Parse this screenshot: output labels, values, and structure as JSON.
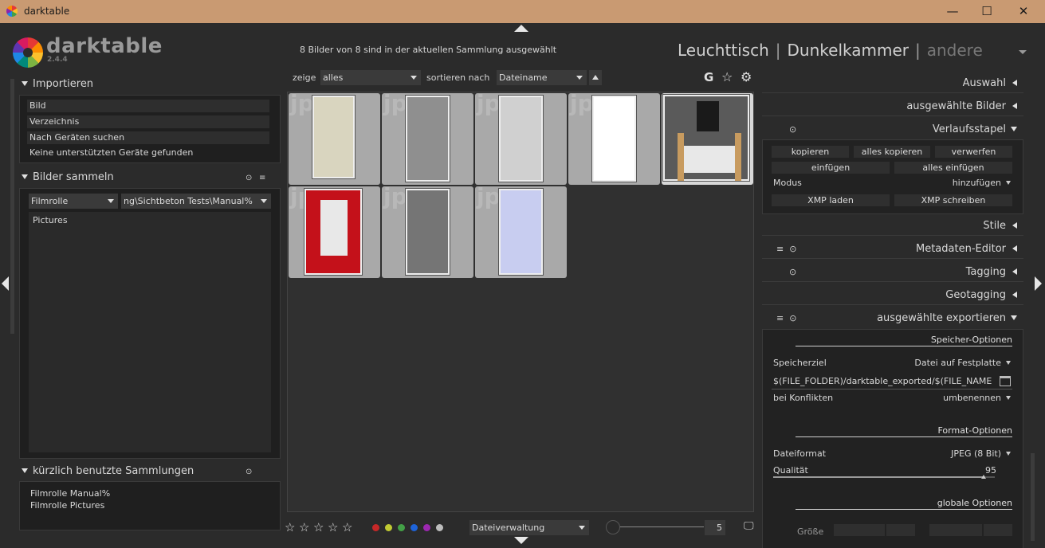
{
  "window": {
    "title": "darktable",
    "minimize": "—",
    "maximize": "☐",
    "close": "✕"
  },
  "logo": {
    "name": "darktable",
    "version": "2.4.4"
  },
  "header": {
    "info": "8 Bilder von 8 sind in der aktuellen Sammlung ausgewählt",
    "views": {
      "lighttable": "Leuchttisch",
      "darkroom": "Dunkelkammer",
      "other": "andere",
      "separator": "|"
    }
  },
  "left": {
    "import": {
      "title": "Importieren",
      "items": [
        "Bild",
        "Verzeichnis",
        "Nach Geräten suchen"
      ],
      "note": "Keine unterstützten Geräte gefunden"
    },
    "collect": {
      "title": "Bilder sammeln",
      "property": "Filmrolle",
      "path": "ng\\Sichtbeton Tests\\Manual%",
      "list": [
        "Pictures"
      ]
    },
    "recent": {
      "title": "kürzlich benutzte Sammlungen",
      "items": [
        "Filmrolle Manual%",
        "Filmrolle Pictures"
      ]
    }
  },
  "filter": {
    "show_label": "zeige",
    "show_value": "alles",
    "sort_label": "sortieren nach",
    "sort_value": "Dateiname",
    "icons": {
      "grouping": "G",
      "star": "☆",
      "gear": "⚙"
    }
  },
  "thumbnails": [
    {
      "watermark": "jp",
      "fill": "#d9d5bf",
      "selected": false
    },
    {
      "watermark": "jp",
      "fill": "#8f8f8f",
      "selected": false
    },
    {
      "watermark": "jp",
      "fill": "#d0d0d0",
      "selected": false
    },
    {
      "watermark": "jp",
      "fill": "#ffffff",
      "selected": false
    },
    {
      "watermark": "",
      "fill": "#5a5a5a",
      "selected": true
    },
    {
      "watermark": "jp",
      "fill": "#c4111a",
      "selected": false
    },
    {
      "watermark": "jp",
      "fill": "#757575",
      "selected": false
    },
    {
      "watermark": "jp",
      "fill": "#c8cdf0",
      "selected": false
    }
  ],
  "bottom": {
    "stars": [
      "☆",
      "☆",
      "☆",
      "☆",
      "☆"
    ],
    "colors": [
      "#c62828",
      "#c0ca33",
      "#43a047",
      "#1e63d8",
      "#9c27b0",
      "#bdbdbd"
    ],
    "layout_value": "Dateiverwaltung",
    "zoom_value": "5",
    "display_icon": "🖵"
  },
  "right": {
    "select": "Auswahl",
    "selected_images": "ausgewählte Bilder",
    "history": {
      "title": "Verlaufsstapel",
      "copy": "kopieren",
      "copy_all": "alles kopieren",
      "discard": "verwerfen",
      "paste": "einfügen",
      "paste_all": "alles einfügen",
      "mode_label": "Modus",
      "mode_value": "hinzufügen",
      "load_xmp": "XMP laden",
      "write_xmp": "XMP schreiben"
    },
    "styles": "Stile",
    "metadata": "Metadaten-Editor",
    "tagging": "Tagging",
    "geotagging": "Geotagging",
    "export": {
      "title": "ausgewählte exportieren",
      "storage_options": "Speicher-Optionen",
      "target_label": "Speicherziel",
      "target_value": "Datei auf Festplatte",
      "path": "$(FILE_FOLDER)/darktable_exported/$(FILE_NAME",
      "conflict_label": "bei Konflikten",
      "conflict_value": "umbenennen",
      "format_options": "Format-Optionen",
      "format_label": "Dateiformat",
      "format_value": "JPEG (8 Bit)",
      "quality_label": "Qualität",
      "quality_value": "95",
      "global_options": "globale Optionen",
      "size_label": "Größe"
    }
  }
}
